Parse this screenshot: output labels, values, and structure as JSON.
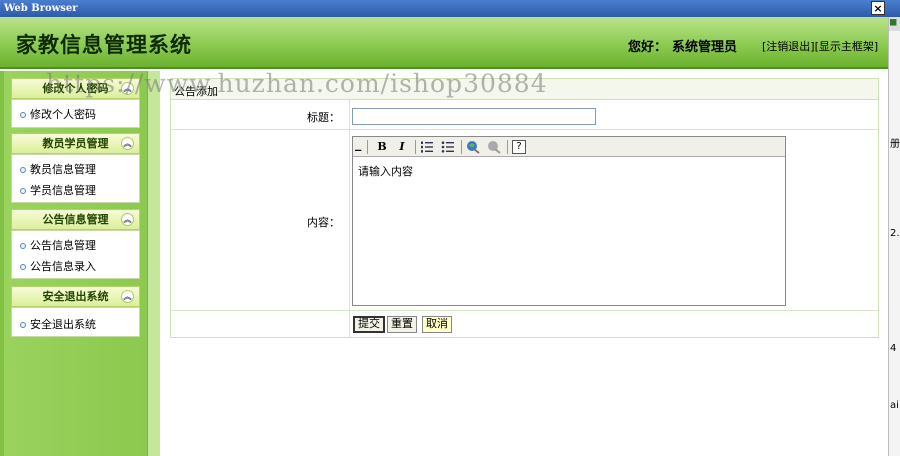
{
  "window": {
    "title": "Web Browser",
    "close_glyph": "×"
  },
  "header": {
    "app_title": "家教信息管理系统",
    "greeting": "您好：",
    "username": "系统管理员",
    "logout_link": "[注销退出]",
    "main_frame_link": "[显示主框架]"
  },
  "sidebar": {
    "sections": [
      {
        "title": "修改个人密码",
        "items": [
          "修改个人密码"
        ]
      },
      {
        "title": "教员学员管理",
        "items": [
          "教员信息管理",
          "学员信息管理"
        ]
      },
      {
        "title": "公告信息管理",
        "items": [
          "公告信息管理",
          "公告信息录入"
        ]
      },
      {
        "title": "安全退出系统",
        "items": [
          "安全退出系统"
        ]
      }
    ],
    "collapse_glyph": "︽"
  },
  "form": {
    "section_title": "公告添加",
    "title_label": "标题：",
    "title_value": "",
    "content_label": "内容：",
    "content_value": "请输入内容",
    "toolbar": {
      "bold": "B",
      "italic": "I",
      "help": "?"
    },
    "submit_label": "提交",
    "reset_label": "重置",
    "cancel_label": "取消"
  },
  "watermark": "https://www.huzhan.com/ishop30884",
  "right_edge_fragments": [
    "册",
    "2.",
    "4",
    "ai"
  ]
}
